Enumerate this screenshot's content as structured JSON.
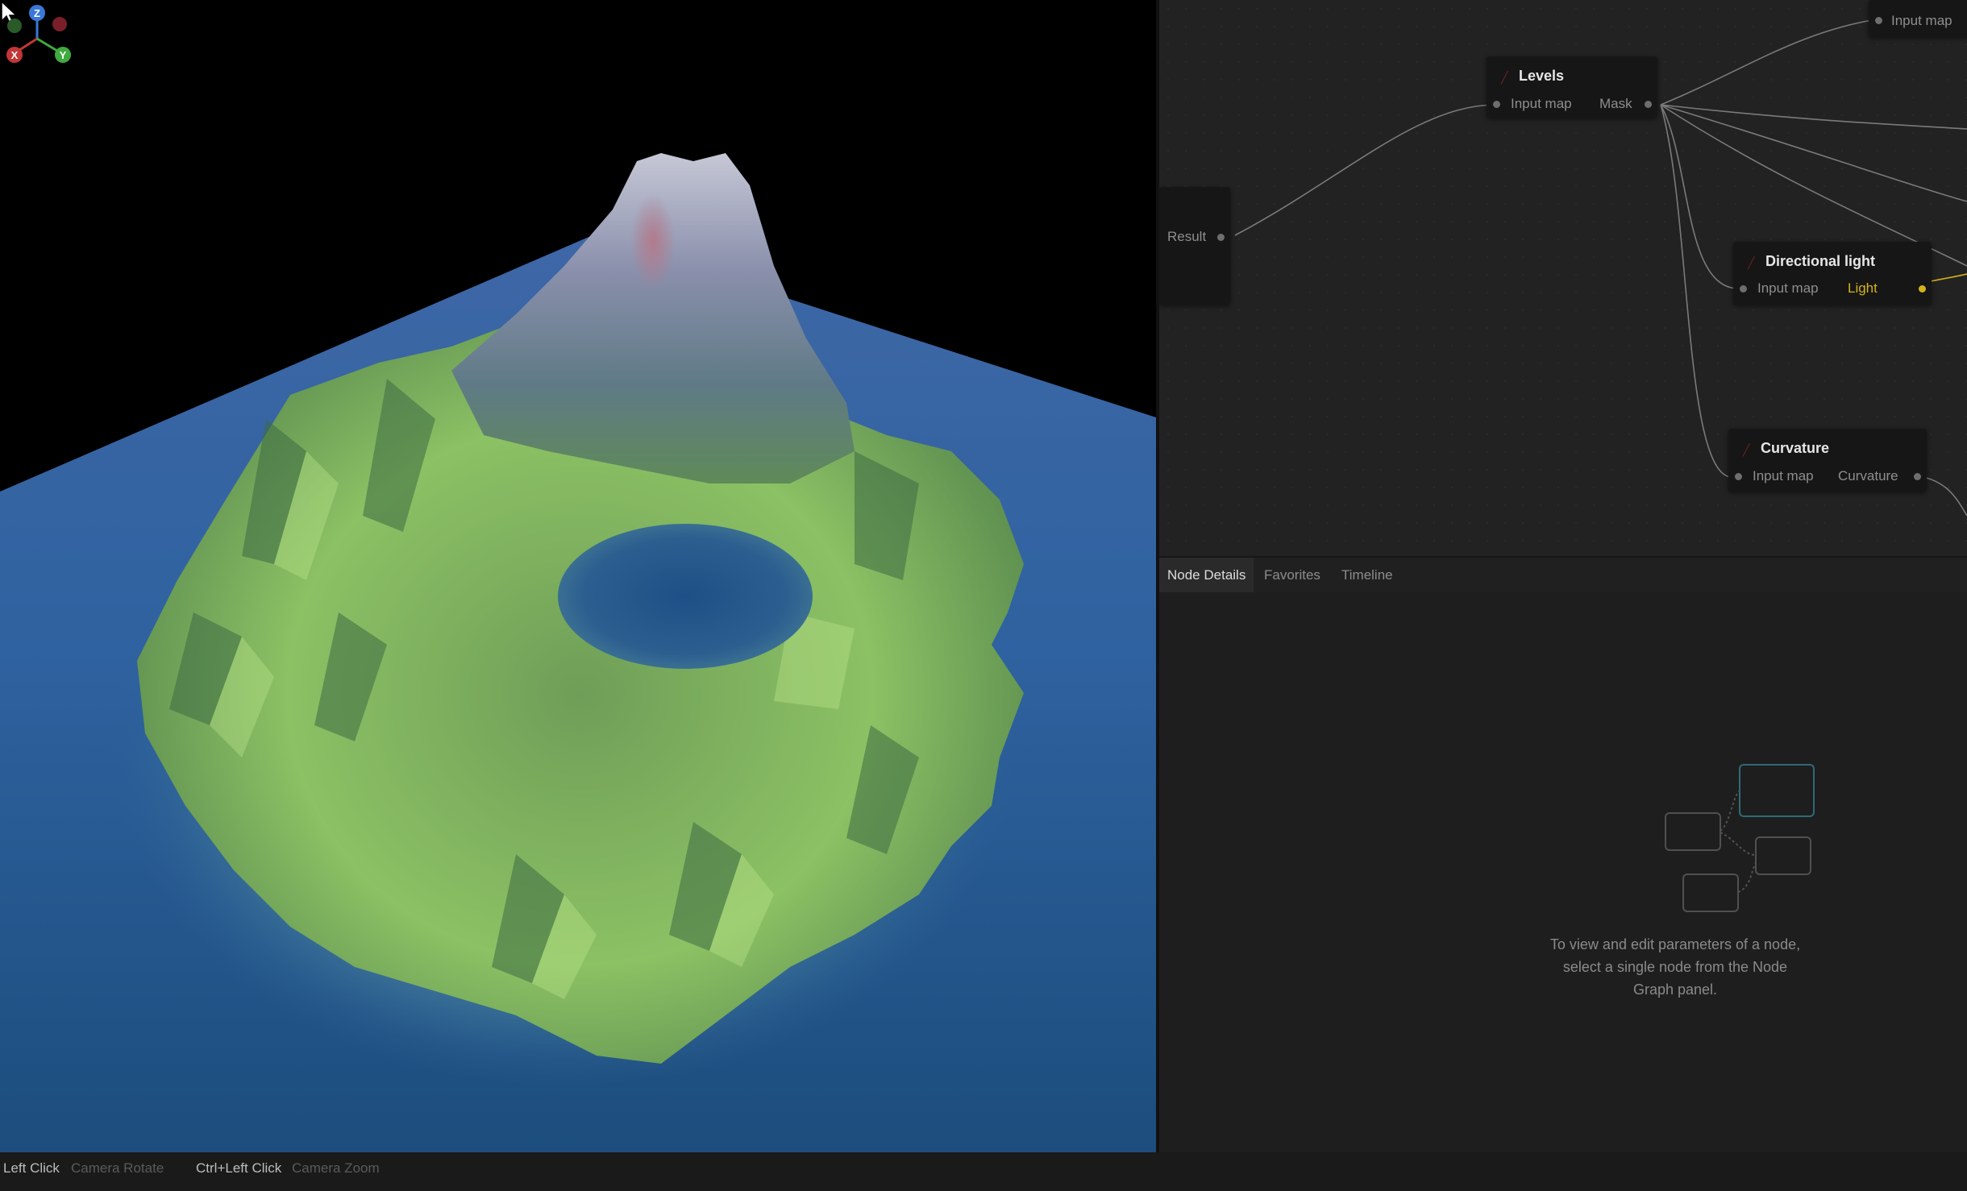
{
  "status_bar": {
    "hints": [
      {
        "key": "Left Click",
        "action": "Camera Rotate"
      },
      {
        "key": "Ctrl+Left Click",
        "action": "Camera Zoom"
      }
    ]
  },
  "viewport": {
    "gizmo_axes": [
      "Z",
      "X",
      "Y"
    ]
  },
  "node_graph": {
    "nodes": {
      "input_partial": {
        "input": "Input map"
      },
      "levels": {
        "title": "Levels",
        "input": "Input map",
        "output": "Mask"
      },
      "result": {
        "output": "Result"
      },
      "directional_light": {
        "title": "Directional light",
        "input": "Input map",
        "output": "Light"
      },
      "curvature": {
        "title": "Curvature",
        "input": "Input map",
        "output": "Curvature"
      }
    },
    "colors": {
      "light_port": "#d4b21a",
      "wire": "#7a7a7a"
    }
  },
  "details_panel": {
    "tabs": [
      {
        "label": "Node Details",
        "active": true
      },
      {
        "label": "Favorites",
        "active": false
      },
      {
        "label": "Timeline",
        "active": false
      }
    ],
    "empty_message": "To view and edit parameters of a node, select a single node from the Node Graph panel."
  }
}
